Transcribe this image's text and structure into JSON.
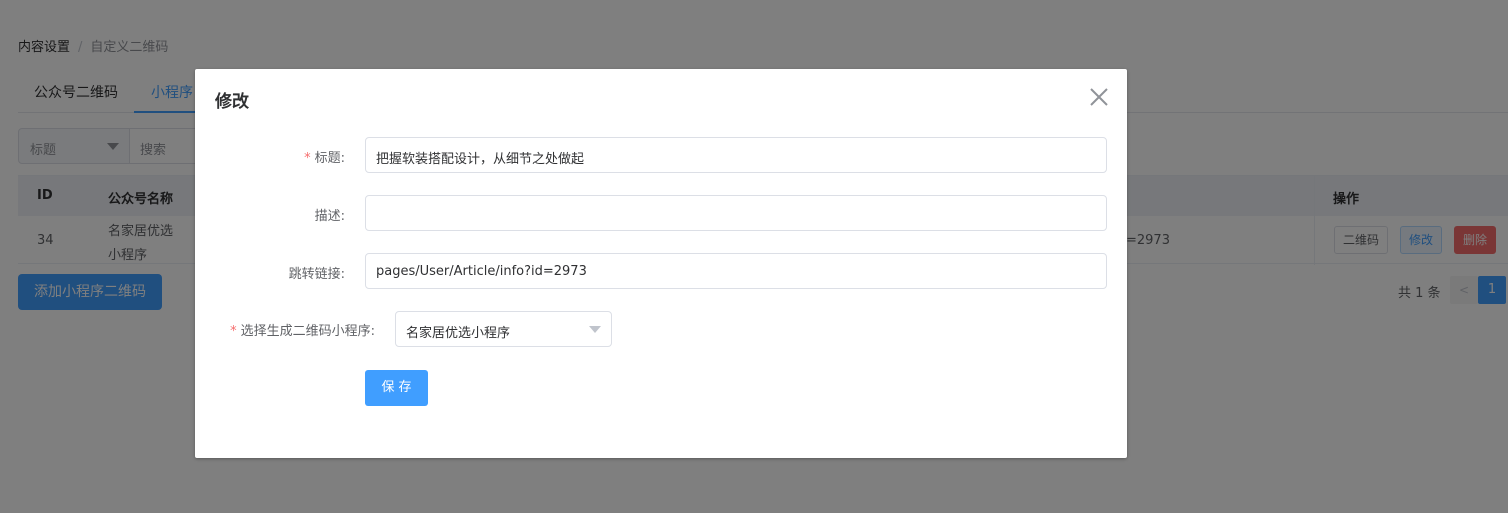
{
  "breadcrumb": {
    "item1": "内容设置",
    "separator": "/",
    "item2": "自定义二维码"
  },
  "tabs": [
    {
      "label": "公众号二维码"
    },
    {
      "label": "小程序"
    }
  ],
  "search": {
    "select_label": "标题",
    "placeholder": "搜索"
  },
  "table": {
    "headers": {
      "id": "ID",
      "name": "公众号名称",
      "operation": "操作"
    },
    "rows": [
      {
        "id": "34",
        "name_line1": "名家居优选",
        "name_line2": "小程序",
        "link_tail": "=2973"
      }
    ],
    "actions": {
      "qrcode": "二维码",
      "edit": "修改",
      "delete": "删除"
    }
  },
  "add_button": "添加小程序二维码",
  "pagination": {
    "total": "共 1 条",
    "prev": "<",
    "current_page": "1"
  },
  "dialog": {
    "title": "修改",
    "fields": {
      "title": {
        "label": "标题:",
        "required_mark": "*",
        "value": "把握软装搭配设计，从细节之处做起"
      },
      "description": {
        "label": "描述:",
        "value": ""
      },
      "link": {
        "label": "跳转链接:",
        "value": "pages/User/Article/info?id=2973"
      },
      "app": {
        "label": "选择生成二维码小程序:",
        "required_mark": "*",
        "value": "名家居优选小程序"
      }
    },
    "save_label": "保存",
    "close_icon": "close-icon"
  },
  "colors": {
    "primary": "#409eff",
    "danger": "#f56c6c",
    "overlay": "rgba(0,0,0,0.5)"
  }
}
